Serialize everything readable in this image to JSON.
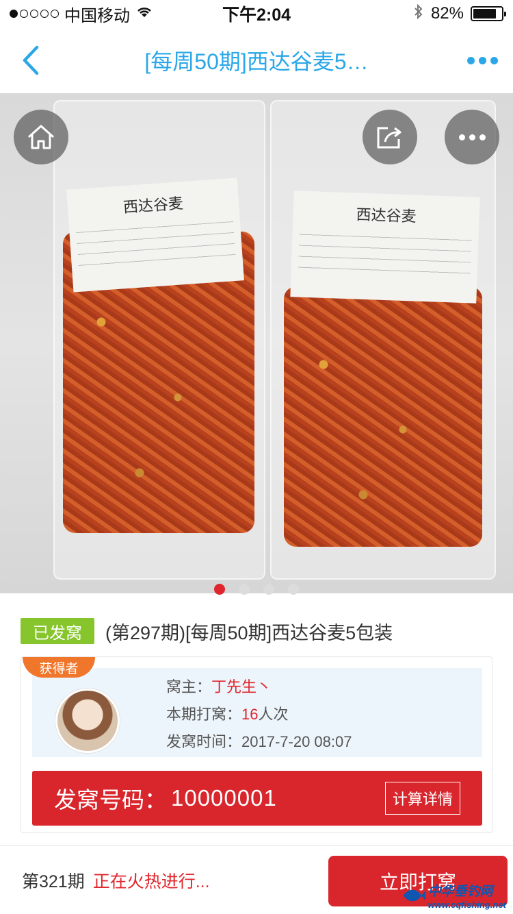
{
  "status_bar": {
    "carrier": "中国移动",
    "time": "下午2:04",
    "battery": "82%",
    "battery_level": 0.82,
    "signal_bars_filled": 1,
    "signal_bars_total": 5
  },
  "nav": {
    "title": "[每周50期]西达谷麦5…"
  },
  "gallery": {
    "bag_label_text": "西达谷麦",
    "page_count": 4,
    "active_page": 1
  },
  "product": {
    "status_tag": "已发窝",
    "title": "(第297期)[每周50期]西达谷麦5包装"
  },
  "winner": {
    "ribbon": "获得者",
    "owner_label": "窝主：",
    "owner_name": "丁先生丶",
    "count_label": "本期打窝：",
    "count_value": "16",
    "count_unit": "人次",
    "time_label": "发窝时间：",
    "time_value": "2017-7-20 08:07"
  },
  "code_bar": {
    "label": "发窝号码：",
    "value": "10000001",
    "detail_button": "计算详情"
  },
  "bottom": {
    "period": "第321期",
    "status": "正在火热进行...",
    "join_button": "立即打窝"
  },
  "watermark": {
    "main": "中华垂钓网",
    "sub": "www.cqfishing.net"
  },
  "colors": {
    "accent_blue": "#2aa7e8",
    "accent_red": "#d9262c",
    "tag_green": "#86c52b",
    "ribbon_orange": "#f0762b"
  },
  "icons": {
    "back": "chevron-left-icon",
    "more": "more-dots-icon",
    "home": "home-icon",
    "share": "share-icon"
  }
}
